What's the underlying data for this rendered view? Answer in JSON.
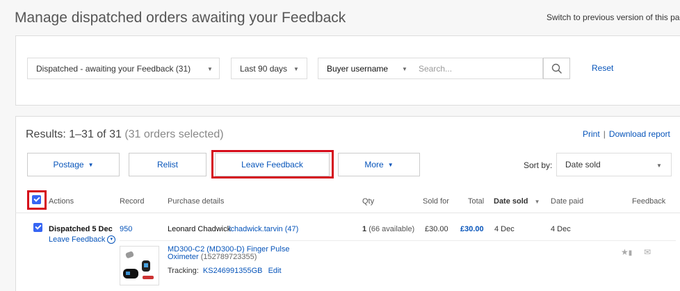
{
  "header": {
    "title": "Manage dispatched orders awaiting your Feedback",
    "switch_link": "Switch to previous version of this page"
  },
  "filters": {
    "status": "Dispatched - awaiting your Feedback (31)",
    "period": "Last 90 days",
    "search_type": "Buyer username",
    "search_placeholder": "Search...",
    "reset": "Reset"
  },
  "results": {
    "summary": "Results: 1–31 of 31",
    "selected": "(31 orders selected)",
    "print": "Print",
    "separator": "|",
    "download": "Download report"
  },
  "toolbar": {
    "postage": "Postage",
    "relist": "Relist",
    "leave_feedback": "Leave Feedback",
    "more": "More",
    "sort_by_label": "Sort by:",
    "sort_value": "Date sold"
  },
  "columns": {
    "actions": "Actions",
    "record": "Record",
    "purchase_details": "Purchase details",
    "qty": "Qty",
    "sold_for": "Sold for",
    "total": "Total",
    "date_sold": "Date sold",
    "date_paid": "Date paid",
    "feedback": "Feedback"
  },
  "order": {
    "status": "Dispatched 5 Dec",
    "leave_feedback": "Leave Feedback",
    "record": "950",
    "buyer_name": "Leonard Chadwick",
    "buyer_user": "lchadwick.tarvin (47)",
    "qty": "1",
    "qty_available": "(66 available)",
    "sold_for": "£30.00",
    "total": "£30.00",
    "date_sold": "4 Dec",
    "date_paid": "4 Dec",
    "item_title_line1": "MD300-C2 (MD300-D) Finger Pulse",
    "item_title_line2": "Oximeter",
    "item_id": "(152789723355)",
    "tracking_label": "Tracking:",
    "tracking_number": "KS246991355GB",
    "edit": "Edit"
  }
}
